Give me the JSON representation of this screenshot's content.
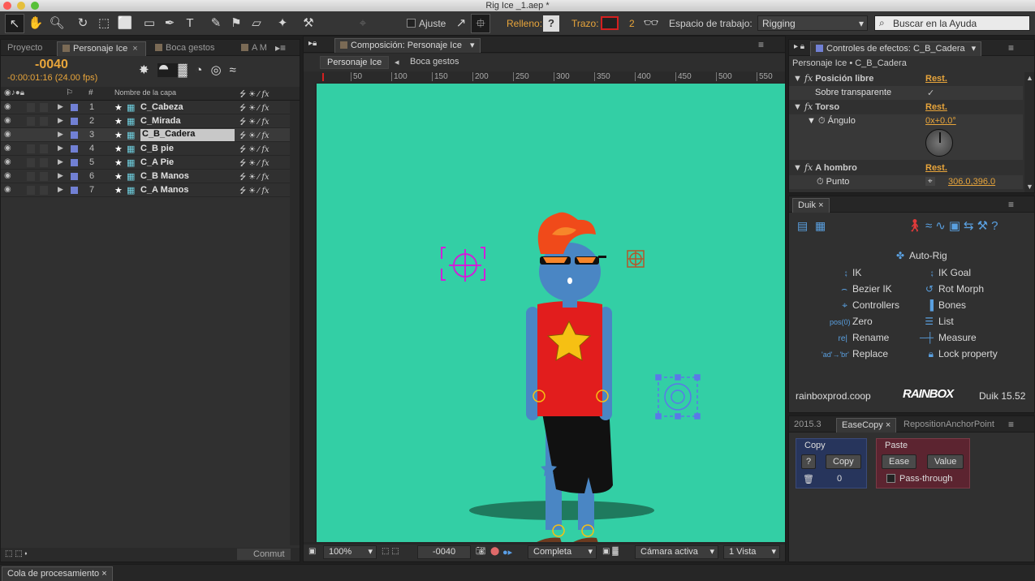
{
  "window": {
    "title": "Rig Ice _1.aep *"
  },
  "toolbar": {
    "snap_label": "Ajuste",
    "fill_label": "Relleno:",
    "stroke_label": "Trazo:",
    "stroke_value": "2",
    "workspace_label": "Espacio de trabajo:",
    "workspace_value": "Rigging",
    "search_placeholder": "Buscar en la Ayuda"
  },
  "left_panel": {
    "tabs": [
      "Proyecto",
      "Personaje Ice",
      "Boca gestos",
      "A M"
    ],
    "timecode": "-0040",
    "timecode_sub": "-0:00:01:16 (24.00 fps)",
    "col_num": "#",
    "col_name": "Nombre de la capa",
    "layers": [
      {
        "num": "1",
        "name": "C_Cabeza"
      },
      {
        "num": "2",
        "name": "C_Mirada"
      },
      {
        "num": "3",
        "name": "C_B_Cadera"
      },
      {
        "num": "4",
        "name": "C_B pie"
      },
      {
        "num": "5",
        "name": "C_A Pie"
      },
      {
        "num": "6",
        "name": "C_B Manos"
      },
      {
        "num": "7",
        "name": "C_A Manos"
      }
    ],
    "bottom_btn": "Conmut"
  },
  "composition": {
    "panel_title": "Composición: Personaje Ice",
    "tabs": [
      "Personaje Ice",
      "Boca gestos"
    ],
    "ruler_ticks": [
      "50",
      "100",
      "150",
      "200",
      "250",
      "300",
      "350",
      "400",
      "450",
      "500",
      "550"
    ],
    "footer": {
      "zoom": "100%",
      "time": "-0040",
      "quality": "Completa",
      "camera": "Cámara activa",
      "view": "1 Vista"
    }
  },
  "effects": {
    "panel_title": "Controles de efectos: C_B_Cadera",
    "path": "Personaje Ice • C_B_Cadera",
    "reset": "Rest.",
    "items": [
      {
        "name": "Posición libre"
      },
      {
        "name": "Sobre transparente"
      },
      {
        "name": "Torso"
      },
      {
        "name": "Ángulo",
        "value": "0x+0.0°"
      },
      {
        "name": "A hombro"
      },
      {
        "name": "Punto",
        "value": "306.0,396.0"
      }
    ]
  },
  "duik": {
    "tab": "Duik",
    "items": {
      "autorig": "Auto-Rig",
      "ik": "IK",
      "ikgoal": "IK Goal",
      "bezier": "Bezier IK",
      "rotmorph": "Rot Morph",
      "controllers": "Controllers",
      "bones": "Bones",
      "zero": "Zero",
      "list": "List",
      "rename": "Rename",
      "measure": "Measure",
      "replace": "Replace",
      "lock": "Lock property"
    },
    "footer_left": "rainboxprod.coop",
    "footer_version": "Duik 15.52",
    "logo": "RAINBOX"
  },
  "easecopy": {
    "tabs": [
      "2015.3",
      "EaseCopy",
      "RepositionAnchorPoint"
    ],
    "copy_group": "Copy",
    "help_btn": "?",
    "copy_btn": "Copy",
    "count": "0",
    "paste_group": "Paste",
    "ease_btn": "Ease",
    "value_btn": "Value",
    "passthrough": "Pass-through"
  },
  "bottom": {
    "tab": "Cola de procesamiento"
  },
  "colors": {
    "accent": "#e8a53b",
    "canvas": "#33cfa5",
    "label": "#7180d4"
  }
}
